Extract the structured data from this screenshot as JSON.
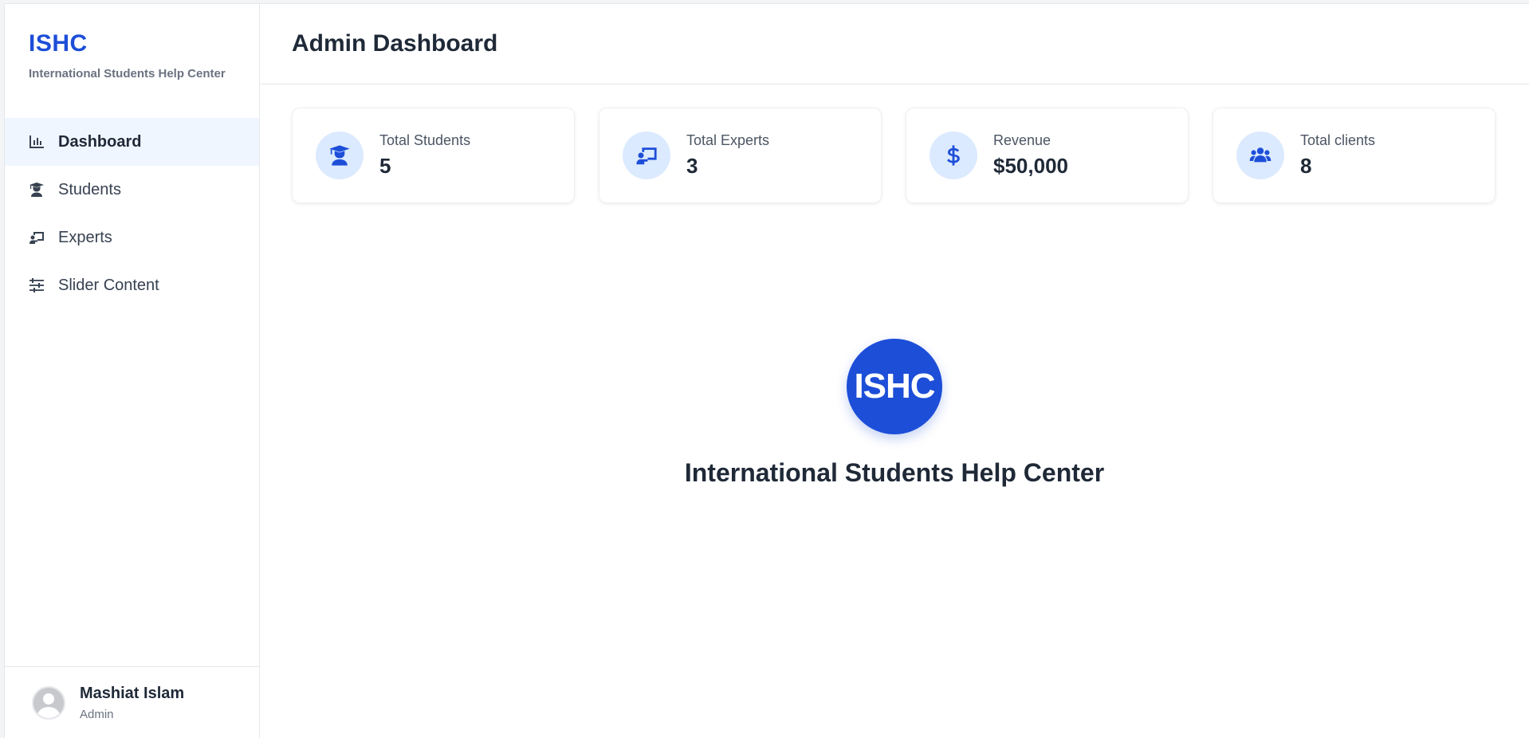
{
  "brand": {
    "title": "ISHC",
    "subtitle": "International Students Help Center"
  },
  "sidebar": {
    "items": [
      {
        "label": "Dashboard",
        "icon": "chart-bar-icon",
        "active": true
      },
      {
        "label": "Students",
        "icon": "graduate-icon",
        "active": false
      },
      {
        "label": "Experts",
        "icon": "teacher-board-icon",
        "active": false
      },
      {
        "label": "Slider Content",
        "icon": "sliders-icon",
        "active": false
      }
    ]
  },
  "user": {
    "name": "Mashiat Islam",
    "role": "Admin"
  },
  "header": {
    "title": "Admin Dashboard"
  },
  "stats": [
    {
      "label": "Total Students",
      "value": "5",
      "icon": "graduate-icon"
    },
    {
      "label": "Total Experts",
      "value": "3",
      "icon": "teacher-board-icon"
    },
    {
      "label": "Revenue",
      "value": "$50,000",
      "icon": "dollar-icon"
    },
    {
      "label": "Total clients",
      "value": "8",
      "icon": "users-icon"
    }
  ],
  "hero": {
    "logo_text": "ISHC",
    "title": "International Students Help Center"
  },
  "colors": {
    "accent": "#1d4ed8",
    "accent_light": "#dbeafe",
    "active_nav_bg": "#eff6ff"
  }
}
